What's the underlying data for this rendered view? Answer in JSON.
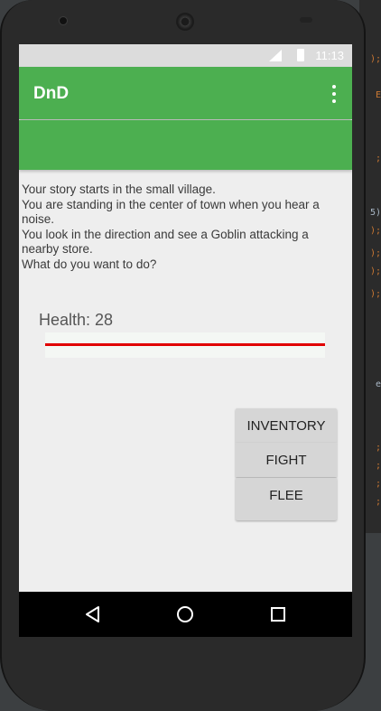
{
  "app": {
    "title": "DnD"
  },
  "status_bar": {
    "time": "11:13"
  },
  "story": {
    "lines": [
      "Your story starts in the small village.",
      "You are standing in the center of town when you hear a noise.",
      "You look in the direction and see a Goblin attacking a nearby store.",
      "What do you want to do?"
    ]
  },
  "health": {
    "label": "Health: 28",
    "bar_fill_fraction": 1.0,
    "bar_color": "#e10000"
  },
  "actions": {
    "inventory_label": "INVENTORY",
    "fight_label": "FIGHT",
    "flee_label": "FLEE"
  },
  "navigation": {
    "back_icon": "back-triangle-icon",
    "home_icon": "home-circle-icon",
    "recents_icon": "recents-square-icon"
  },
  "colors": {
    "primary": "#4caf50",
    "background": "#eeeeee"
  }
}
